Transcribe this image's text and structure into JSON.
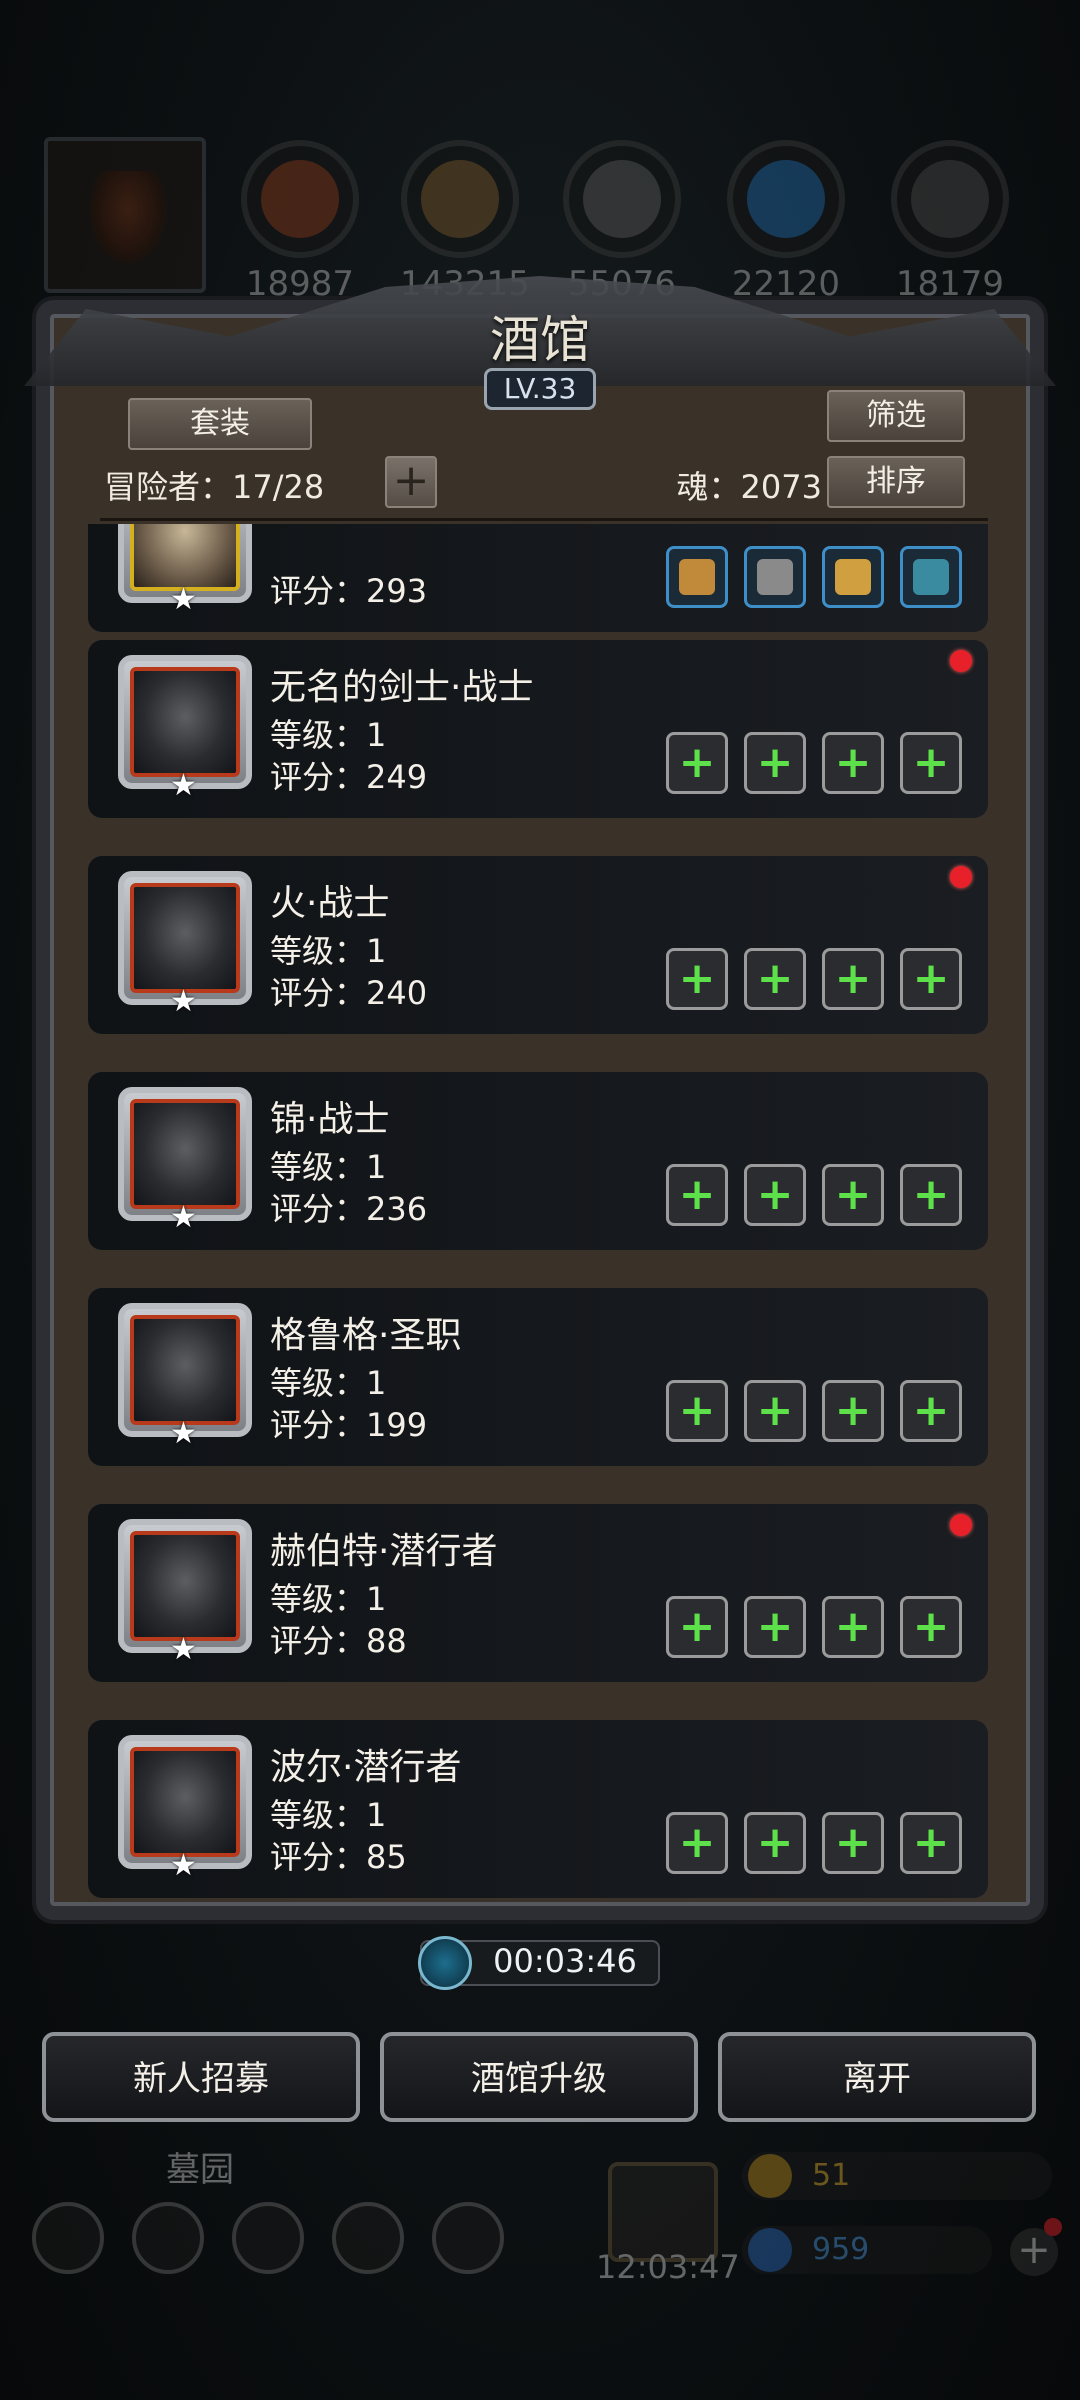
{
  "resources": [
    {
      "icon": "meat-icon",
      "value": "18987",
      "color": "#8a3a1a"
    },
    {
      "icon": "wood-icon",
      "value": "143215",
      "color": "#7a5a2a"
    },
    {
      "icon": "stone-icon",
      "value": "55076",
      "color": "#5a5a5a"
    },
    {
      "icon": "crystal-icon",
      "value": "22120",
      "color": "#1f6aa8"
    },
    {
      "icon": "iron-icon",
      "value": "18179",
      "color": "#4a4a4a"
    }
  ],
  "panel": {
    "title": "酒馆",
    "level": "LV.33",
    "set_button": "套装",
    "filter_button": "筛选",
    "sort_button": "排序",
    "adventurers": "冒险者：17/28",
    "add_button": "+",
    "soul": "魂：2073"
  },
  "heroes": [
    {
      "name": "",
      "level": "",
      "score": "评分：293",
      "alert": false,
      "equipped": true
    },
    {
      "name": "无名的剑士·战士",
      "level": "等级：1",
      "score": "评分：249",
      "alert": true,
      "equipped": false
    },
    {
      "name": "火·战士",
      "level": "等级：1",
      "score": "评分：240",
      "alert": true,
      "equipped": false
    },
    {
      "name": "锦·战士",
      "level": "等级：1",
      "score": "评分：236",
      "alert": false,
      "equipped": false
    },
    {
      "name": "格鲁格·圣职",
      "level": "等级：1",
      "score": "评分：199",
      "alert": false,
      "equipped": false
    },
    {
      "name": "赫伯特·潜行者",
      "level": "等级：1",
      "score": "评分：88",
      "alert": true,
      "equipped": false
    },
    {
      "name": "波尔·潜行者",
      "level": "等级：1",
      "score": "评分：85",
      "alert": false,
      "equipped": false
    }
  ],
  "star_glyph": "★",
  "plus_glyph": "+",
  "timer": "00:03:46",
  "actions": {
    "recruit": "新人招募",
    "upgrade": "酒馆升级",
    "leave": "离开"
  },
  "hud": {
    "area_name": "墓园",
    "clock": "12:03:47",
    "gold": "51",
    "gems": "959"
  }
}
